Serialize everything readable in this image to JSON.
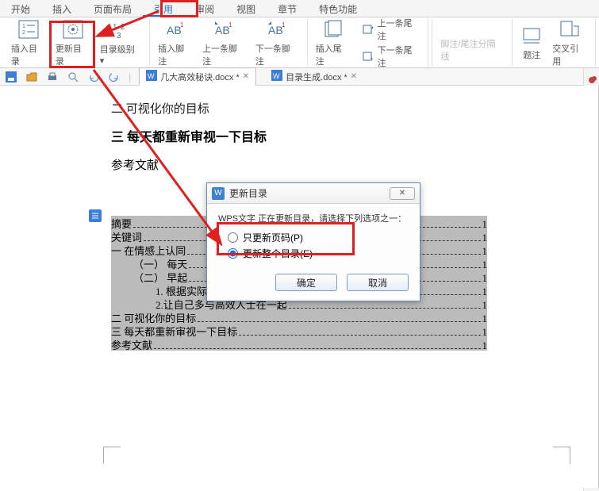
{
  "menu": {
    "tabs": [
      "开始",
      "插入",
      "页面布局",
      "引用",
      "审阅",
      "视图",
      "章节",
      "特色功能"
    ],
    "active_index": 3
  },
  "ribbon": {
    "insert_toc": "插入目录",
    "update_toc": "更新目录",
    "toc_level": "目录级别",
    "insert_footnote": "插入脚注",
    "prev_footnote": "上一条脚注",
    "next_footnote": "下一条脚注",
    "insert_endnote": "插入尾注",
    "prev_endnote": "上一条尾注",
    "next_endnote": "下一条尾注",
    "separator": "脚注/尾注分隔线",
    "caption": "题注",
    "crossref": "交叉引用"
  },
  "doc_tabs": {
    "tab1": "几大高效秘诀.docx *",
    "tab2": "目录生成.docx *"
  },
  "document": {
    "line1": "二 可视化你的目标",
    "line2": "三 每天都重新审视一下目标",
    "ref": "参考文献",
    "toc": [
      {
        "text": "摘要",
        "page": "1",
        "indent": 0
      },
      {
        "text": "关键词",
        "page": "1",
        "indent": 0
      },
      {
        "text": "一 在情感上认同",
        "page": "1",
        "indent": 0
      },
      {
        "text": "（一） 每天",
        "page": "1",
        "indent": 1
      },
      {
        "text": "（二） 早起",
        "page": "1",
        "indent": 1
      },
      {
        "text": "1. 根据实际工作为身体补充能量",
        "page": "1",
        "indent": 2
      },
      {
        "text": "2.让自己多与高效人士在一起",
        "page": "1",
        "indent": 2
      },
      {
        "text": "二 可视化你的目标",
        "page": "1",
        "indent": 0
      },
      {
        "text": "三 每天都重新审视一下目标",
        "page": "1",
        "indent": 0
      },
      {
        "text": "参考文献",
        "page": "1",
        "indent": 0
      }
    ]
  },
  "dialog": {
    "title": "更新目录",
    "message": "WPS文字 正在更新目录，请选择下列选项之一：",
    "opt1": "只更新页码(P)",
    "opt2": "更新整个目录(E)",
    "ok": "确定",
    "cancel": "取消",
    "selected": "opt2"
  }
}
